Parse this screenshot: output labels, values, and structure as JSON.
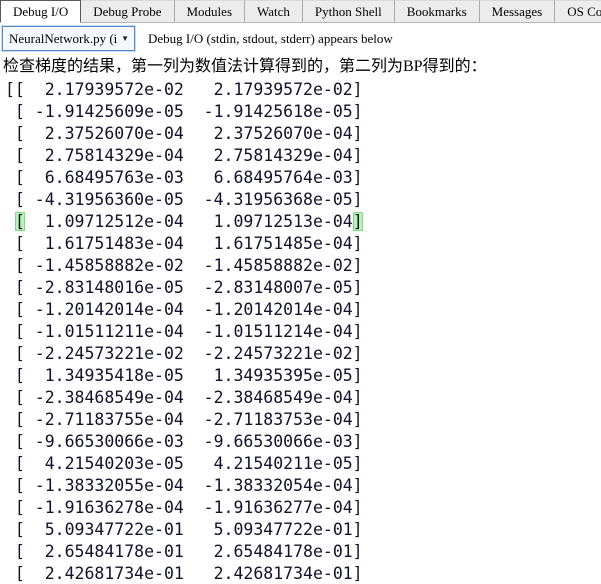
{
  "tabs": {
    "items": [
      {
        "label": "Debug I/O",
        "active": true
      },
      {
        "label": "Debug Probe",
        "active": false
      },
      {
        "label": "Modules",
        "active": false
      },
      {
        "label": "Watch",
        "active": false
      },
      {
        "label": "Python Shell",
        "active": false
      },
      {
        "label": "Bookmarks",
        "active": false
      },
      {
        "label": "Messages",
        "active": false
      },
      {
        "label": "OS Commands",
        "active": false
      }
    ]
  },
  "toolbar": {
    "process_selector_value": "NeuralNetwork.py (i",
    "dropdown_arrow": "▼",
    "description": "Debug I/O (stdin, stdout, stderr) appears below"
  },
  "output": {
    "header_line": "检查梯度的结果，第一列为数值法计算得到的，第二列为BP得到的：",
    "highlighted_row_index": 6,
    "rows": [
      "[[  2.17939572e-02   2.17939572e-02]",
      " [ -1.91425609e-05  -1.91425618e-05]",
      " [  2.37526070e-04   2.37526070e-04]",
      " [  2.75814329e-04   2.75814329e-04]",
      " [  6.68495763e-03   6.68495764e-03]",
      " [ -4.31956360e-05  -4.31956368e-05]",
      " [  1.09712512e-04   1.09712513e-04]",
      " [  1.61751483e-04   1.61751485e-04]",
      " [ -1.45858882e-02  -1.45858882e-02]",
      " [ -2.83148016e-05  -2.83148007e-05]",
      " [ -1.20142014e-04  -1.20142014e-04]",
      " [ -1.01511211e-04  -1.01511214e-04]",
      " [ -2.24573221e-02  -2.24573221e-02]",
      " [  1.34935418e-05   1.34935395e-05]",
      " [ -2.38468549e-04  -2.38468549e-04]",
      " [ -2.71183755e-04  -2.71183753e-04]",
      " [ -9.66530066e-03  -9.66530066e-03]",
      " [  4.21540203e-05   4.21540211e-05]",
      " [ -1.38332055e-04  -1.38332054e-04]",
      " [ -1.91636278e-04  -1.91636277e-04]",
      " [  5.09347722e-01   5.09347722e-01]",
      " [  2.65484178e-01   2.65484178e-01]",
      " [  2.42681734e-01   2.42681734e-01]"
    ]
  },
  "colors": {
    "bracket_highlight_bg": "#b9f3b9",
    "bracket_highlight_border": "#82d882",
    "active_tab_bg": "#ffffff",
    "inactive_tab_bg": "#ececec",
    "dropdown_border": "#5b8ac9",
    "matrix_text": "#12122a"
  }
}
